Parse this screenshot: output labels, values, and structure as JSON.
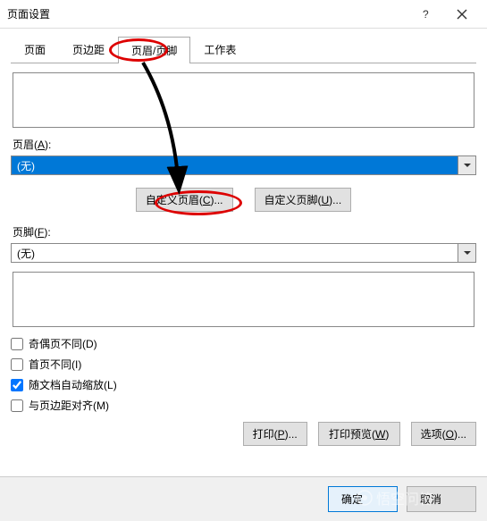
{
  "titlebar": {
    "title": "页面设置"
  },
  "tabs": {
    "page": "页面",
    "margin": "页边距",
    "header_footer": "页眉/页脚",
    "sheet": "工作表"
  },
  "header": {
    "label": "页眉(",
    "key": "A",
    "label_end": "):",
    "value": "(无)"
  },
  "buttons": {
    "custom_header": "自定义页眉(",
    "custom_header_key": "C",
    "custom_header_end": ")...",
    "custom_footer": "自定义页脚(",
    "custom_footer_key": "U",
    "custom_footer_end": ")..."
  },
  "footer": {
    "label": "页脚(",
    "key": "F",
    "label_end": "):",
    "value": "(无)"
  },
  "checks": {
    "odd_even": "奇偶页不同(",
    "odd_even_key": "D",
    "first_page": "首页不同(",
    "first_page_key": "I",
    "scale": "随文档自动缩放(",
    "scale_key": "L",
    "align_margin": "与页边距对齐(",
    "align_margin_key": "M",
    "close": ")"
  },
  "footerBtns": {
    "print": "打印(",
    "print_key": "P",
    "print_end": ")...",
    "preview": "打印预览(",
    "preview_key": "W",
    "preview_end": ")",
    "options": "选项(",
    "options_key": "O",
    "options_end": ")..."
  },
  "bottom": {
    "ok": "确定",
    "cancel": "取消"
  },
  "watermark": "悟空问答"
}
